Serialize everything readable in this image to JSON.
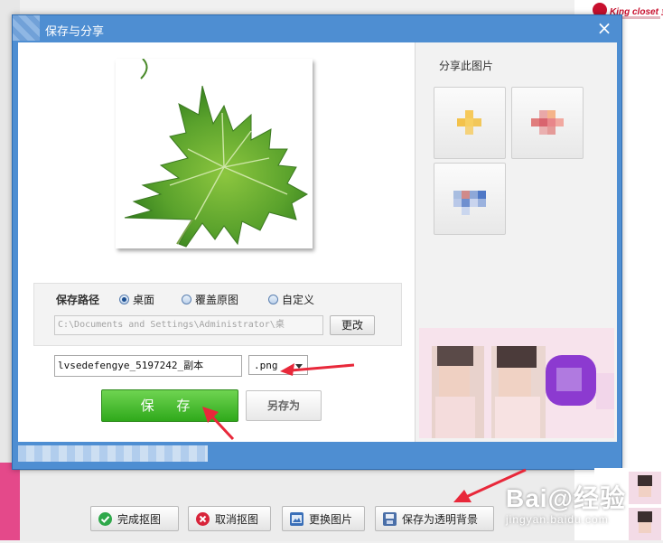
{
  "background": {
    "brand": "King closet 金柜"
  },
  "dialog": {
    "title": "保存与分享",
    "close_glyph": "×",
    "save_path": {
      "label": "保存路径",
      "options": [
        "桌面",
        "覆盖原图",
        "自定义"
      ],
      "selected": "桌面",
      "path_value": "C:\\Documents and Settings\\Administrator\\桌",
      "change_button": "更改"
    },
    "filename": {
      "value": "lvsedefengye_5197242_副本",
      "extension": ".png"
    },
    "save_button": "保 存",
    "save_as_button": "另存为",
    "share": {
      "label": "分享此图片",
      "tiles": [
        "share-tile-1",
        "share-tile-2",
        "share-tile-3"
      ]
    }
  },
  "bottom_toolbar": {
    "buttons": [
      {
        "label": "完成抠图",
        "icon": "check-icon"
      },
      {
        "label": "取消抠图",
        "icon": "cancel-icon"
      },
      {
        "label": "更换图片",
        "icon": "image-icon"
      },
      {
        "label": "保存为透明背景",
        "icon": "save-icon"
      }
    ]
  },
  "watermark": {
    "main": "Bai@经验",
    "sub": "jingyan.baidu.com"
  },
  "colors": {
    "title_bar": "#4e8ed2",
    "save_green": "#2fa91b",
    "arrow_red": "#e8283a"
  }
}
